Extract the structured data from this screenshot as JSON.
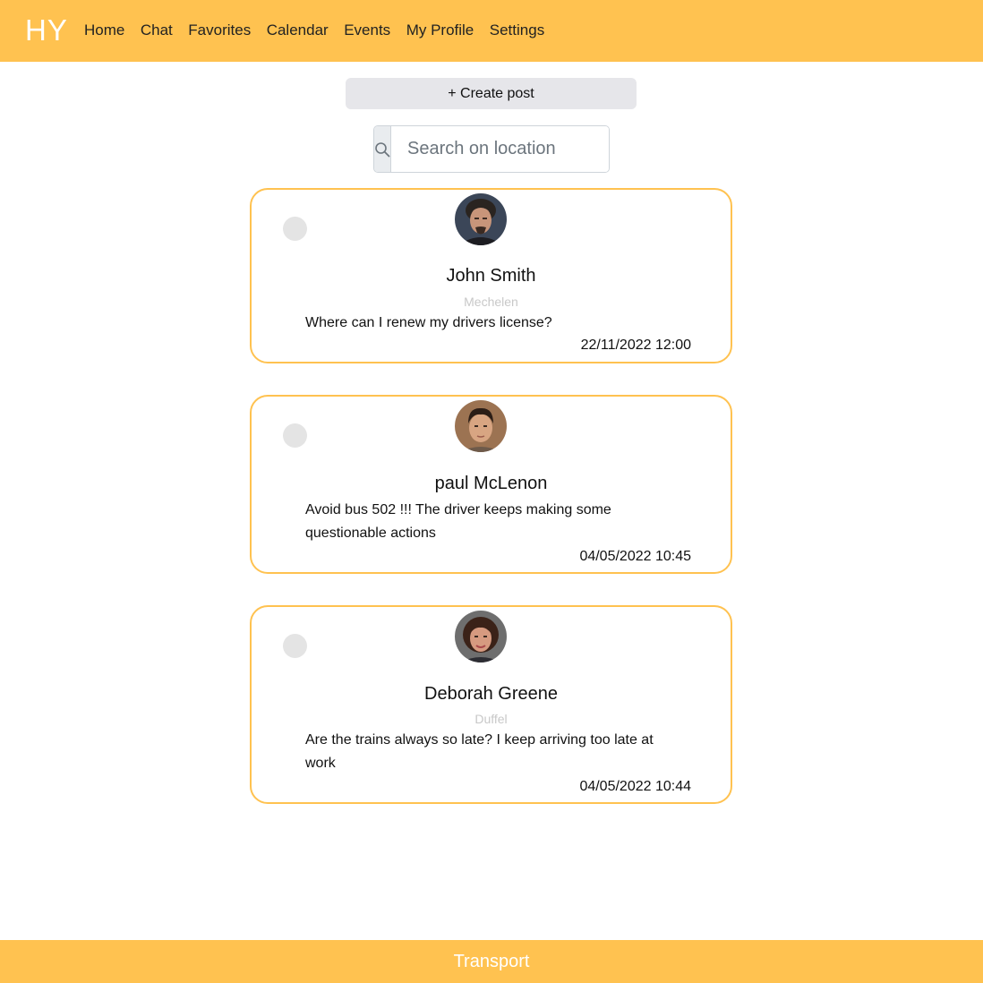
{
  "navbar": {
    "brand": "HY",
    "links": [
      "Home",
      "Chat",
      "Favorites",
      "Calendar",
      "Events",
      "My Profile",
      "Settings"
    ]
  },
  "actions": {
    "create_post_label": "+ Create post"
  },
  "search": {
    "placeholder": "Search on location",
    "icon": "search-icon"
  },
  "posts": [
    {
      "author": "John Smith",
      "location": "Mechelen",
      "message": "Where can I renew my drivers license?",
      "timestamp": "22/11/2022 12:00"
    },
    {
      "author": "paul McLenon",
      "location": "",
      "message": "Avoid bus 502 !!! The driver keeps making some questionable actions",
      "timestamp": "04/05/2022 10:45"
    },
    {
      "author": "Deborah Greene",
      "location": "Duffel",
      "message": "Are the trains always so late? I keep arriving too late at work",
      "timestamp": "04/05/2022 10:44"
    }
  ],
  "footer": {
    "label": "Transport"
  },
  "colors": {
    "accent": "#ffc250",
    "button_bg": "#e6e6ea",
    "placeholder_dot": "#e4e4e4"
  }
}
